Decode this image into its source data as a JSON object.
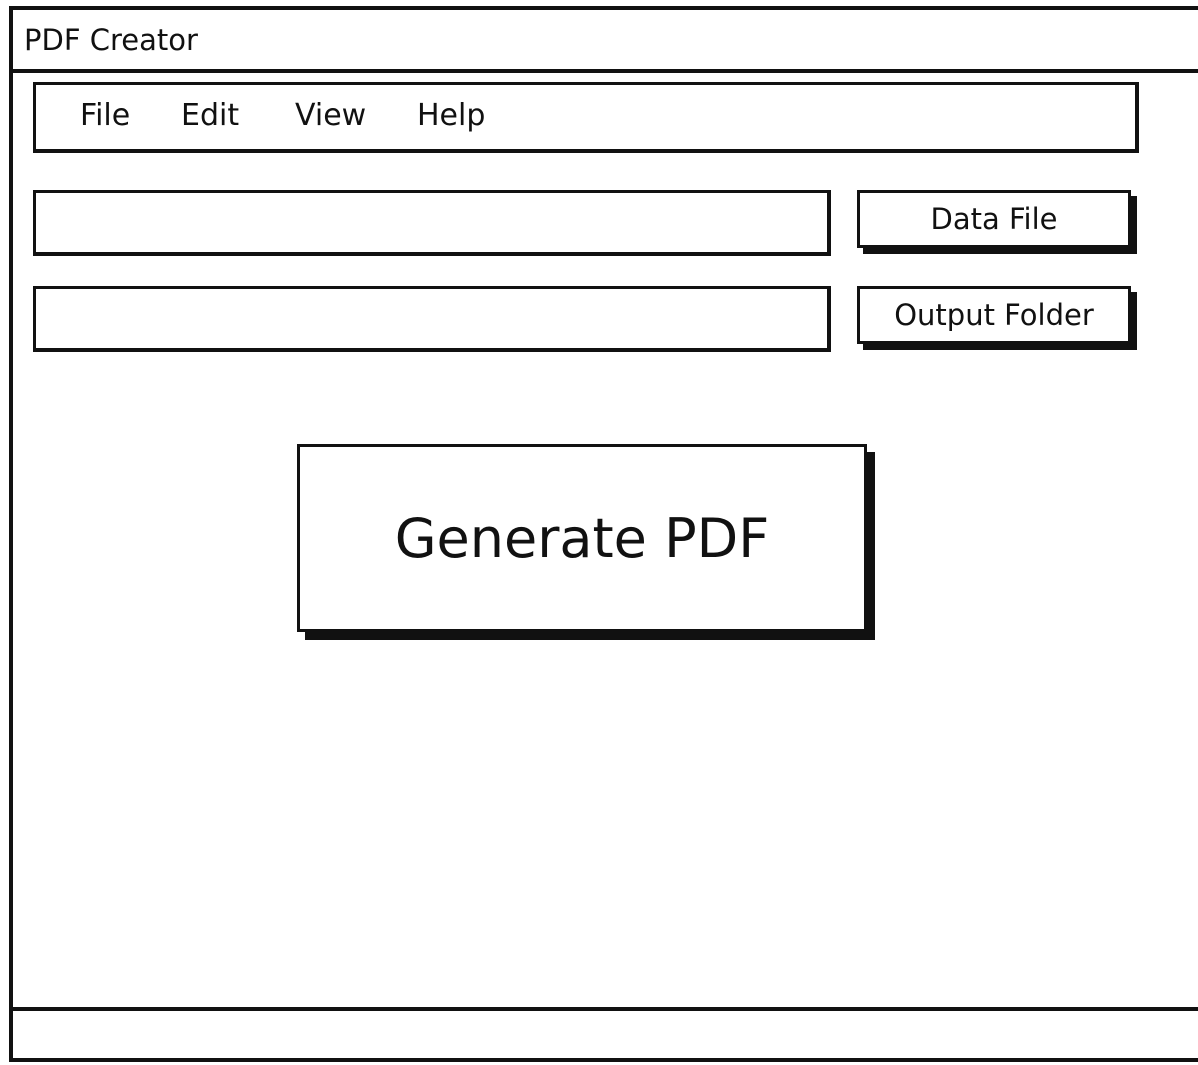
{
  "window": {
    "title": "PDF Creator"
  },
  "menu": {
    "items": [
      {
        "label": "File"
      },
      {
        "label": "Edit"
      },
      {
        "label": "View"
      },
      {
        "label": "Help"
      }
    ]
  },
  "data_file": {
    "value": "",
    "button_label": "Data File"
  },
  "output_folder": {
    "value": "",
    "button_label": "Output Folder"
  },
  "generate": {
    "button_label": "Generate PDF"
  },
  "status_bar": {
    "text": ""
  }
}
